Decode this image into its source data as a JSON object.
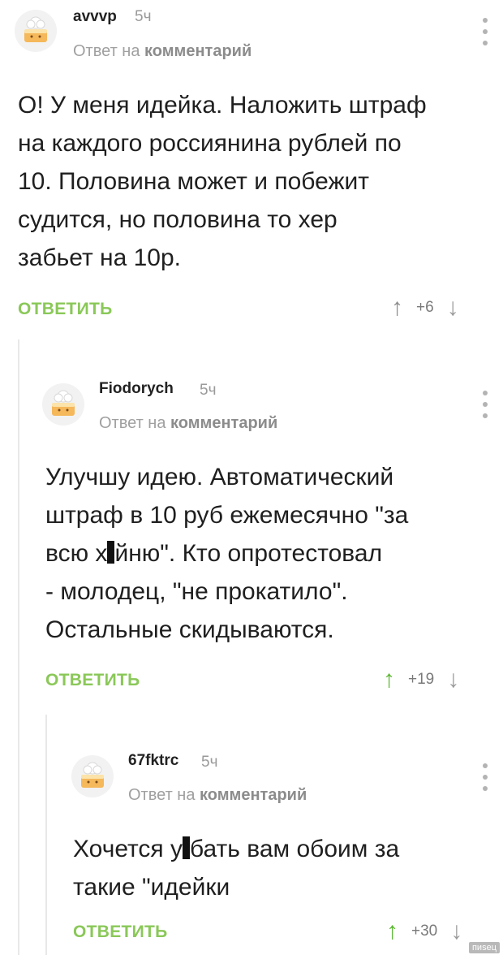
{
  "comments": [
    {
      "username": "avvvp",
      "time": "5ч",
      "reply_prefix": "Ответ на",
      "reply_target": "комментарий",
      "text": "О! У меня идейка. Наложить штраф\nна каждого россиянина рублей по\n10. Половина может и побежит\nсудится, но половина то хер\nзабьет на 10р.",
      "reply_label": "ОТВЕТИТЬ",
      "votes": "+6",
      "up_arrow": "↑",
      "down_arrow": "↓"
    },
    {
      "username": "Fiodorych",
      "time": "5ч",
      "reply_prefix": "Ответ на",
      "reply_target": "комментарий",
      "text_a": "Улучшу идею. Автоматический\nштраф в 10 руб ежемесячно \"за\nвсю х",
      "text_b": "йню\". Кто опротестовал\n- молодец, \"не прокатило\".\nОстальные скидываются.",
      "reply_label": "ОТВЕТИТЬ",
      "votes": "+19",
      "up_arrow": "↑",
      "down_arrow": "↓"
    },
    {
      "username": "67fktrc",
      "time": "5ч",
      "reply_prefix": "Ответ на",
      "reply_target": "комментарий",
      "text_a": "Хочется у",
      "text_b": "бать вам обоим за\nтакие \"идейки",
      "reply_label": "ОТВЕТИТЬ",
      "votes": "+30",
      "up_arrow": "↑",
      "down_arrow": "↓"
    }
  ],
  "watermark": "пиsец",
  "colors": {
    "accent_green": "#8ac858",
    "vote_up_gray": "#8c8c8c",
    "vote_up_green": "#5cb832",
    "meta_gray": "#9a9a9a"
  }
}
